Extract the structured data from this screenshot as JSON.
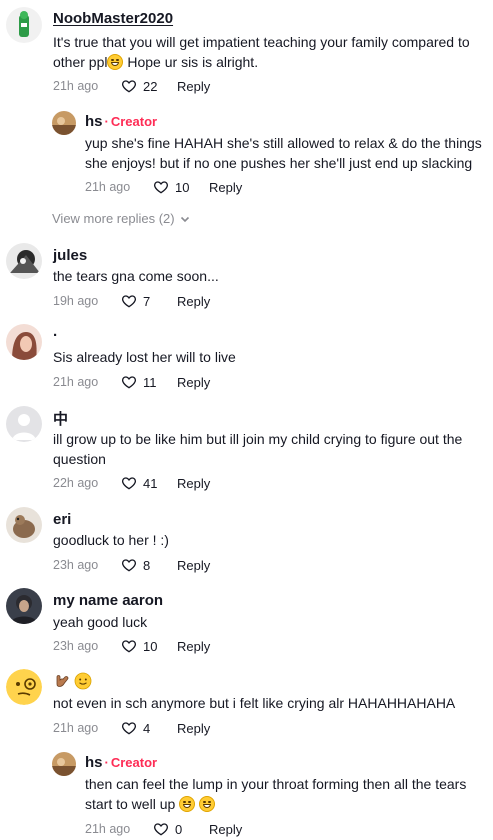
{
  "comments": [
    {
      "username": "NoobMaster2020",
      "text_before_emoji": "It's true that you will get impatient teaching your family compared to other ppl",
      "text_after_emoji": " Hope ur sis is alright.",
      "emoji": "grinning-sweat",
      "time": "21h ago",
      "likes": "22",
      "reply": "Reply",
      "replies": [
        {
          "username": "hs",
          "separator": "·",
          "badge": "Creator",
          "text": "yup she's fine HAHAH she's still allowed to relax & do the things she enjoys! but if no one pushes her she'll just end up slacking",
          "time": "21h ago",
          "likes": "10",
          "reply": "Reply"
        }
      ],
      "view_more": "View more replies (2)"
    },
    {
      "username": "jules",
      "text": "the tears gna come soon...",
      "time": "19h ago",
      "likes": "7",
      "reply": "Reply"
    },
    {
      "username": "·",
      "text": "Sis already lost her will to live",
      "time": "21h ago",
      "likes": "11",
      "reply": "Reply"
    },
    {
      "username": "中",
      "text": "ill grow up to be like him but ill join my child crying to figure out the question",
      "time": "22h ago",
      "likes": "41",
      "reply": "Reply"
    },
    {
      "username": "eri",
      "text": "goodluck to her ! :)",
      "time": "23h ago",
      "likes": "8",
      "reply": "Reply"
    },
    {
      "username": "my name aaron",
      "text": "yeah good luck",
      "time": "23h ago",
      "likes": "10",
      "reply": "Reply"
    },
    {
      "username_emojis": [
        "call-me-hand",
        "slightly-smiling-face"
      ],
      "text": "not even in sch anymore but i felt like crying alr HAHAHHAHAHA",
      "time": "21h ago",
      "likes": "4",
      "reply": "Reply",
      "replies": [
        {
          "username": "hs",
          "separator": "·",
          "badge": "Creator",
          "text": "then can feel the lump in your throat forming then all the tears start to well up",
          "emojis": [
            "grinning-sweat",
            "grinning-sweat"
          ],
          "time": "21h ago",
          "likes": "0",
          "reply": "Reply"
        }
      ]
    }
  ],
  "colors": {
    "creator": "#fe2c55",
    "muted": "#8a8b91",
    "text": "#161823"
  },
  "icons": {
    "like": "heart-outline-icon",
    "expand": "chevron-down-icon"
  }
}
